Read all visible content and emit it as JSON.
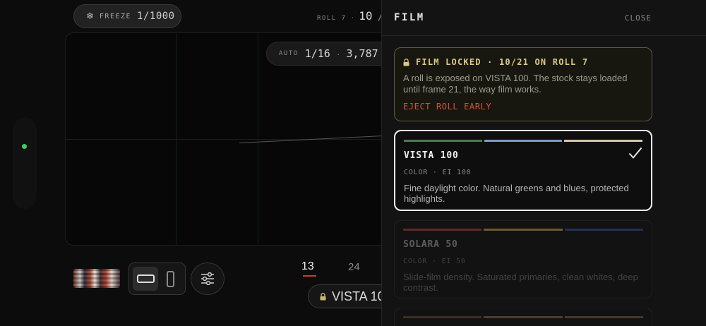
{
  "camera": {
    "freeze": {
      "label": "FREEZE",
      "value": "1/1000"
    },
    "roll": {
      "label": "ROLL 7",
      "current": "10",
      "separator": "/"
    },
    "exposure": {
      "mode": "AUTO",
      "shutter": "1/16",
      "iso": "3,787"
    },
    "frame_counts": [
      {
        "label": "13",
        "active": true
      },
      {
        "label": "24",
        "active": false
      }
    ],
    "film_badge": "VISTA 10",
    "level_indicator_color": "#3fcf5a"
  },
  "sheet": {
    "title": "FILM",
    "close_label": "CLOSE",
    "lock": {
      "title": "FILM LOCKED · 10/21 ON ROLL 7",
      "body": "A roll is exposed on VISTA 100. The stock stays loaded until frame 21, the way film works.",
      "eject_label": "EJECT ROLL EARLY"
    },
    "films": [
      {
        "name": "VISTA 100",
        "meta": "COLOR · EI 100",
        "description": "Fine daylight color. Natural greens and blues, protected highlights.",
        "stripes": [
          "#4e7a52",
          "#7f9cc3",
          "#d6c8a4"
        ]
      },
      {
        "name": "SOLARA 50",
        "meta": "COLOR · EI 50",
        "description": "Slide-film density. Saturated primaries, clean whites, deep contrast.",
        "stripes": [
          "#5c2a26",
          "#6a5a2e",
          "#233152"
        ]
      },
      {
        "stripes": [
          "#3a2f22",
          "#4a3f2a",
          "#4a3826"
        ]
      }
    ],
    "accent_colors": {
      "lock_border": "#5e5a45",
      "lock_title": "#dcc88a",
      "eject": "#d6503a",
      "count_underline": "#d23a2c"
    }
  }
}
